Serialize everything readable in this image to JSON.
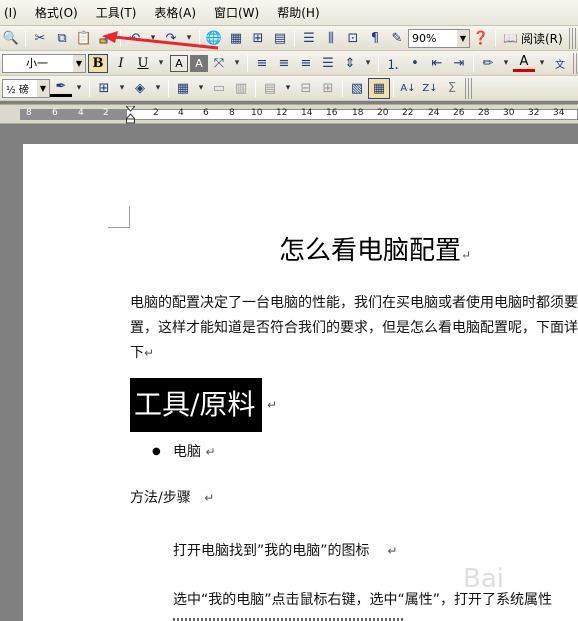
{
  "menu": {
    "items": [
      "(I)",
      "格式(O)",
      "工具(T)",
      "表格(A)",
      "窗口(W)",
      "帮助(H)"
    ]
  },
  "toolbar1": {
    "zoom_value": "90%",
    "read_label": "阅读(R)",
    "icons": [
      "print-preview-icon",
      "cut-icon",
      "copy-icon",
      "paste-icon",
      "format-painter-icon",
      "undo-icon",
      "redo-icon",
      "hyperlink-icon",
      "tables-borders-icon",
      "insert-table-icon",
      "insert-excel-icon",
      "columns-icon",
      "drawing-icon",
      "document-map-icon",
      "show-hide-icon",
      "help-icon"
    ]
  },
  "toolbar2": {
    "font_size": "小一",
    "bold": "B",
    "italic": "I",
    "underline": "U"
  },
  "toolbar3": {
    "line_weight": "½ 磅"
  },
  "ruler": {
    "left_numbers": [
      "8",
      "6",
      "4",
      "2"
    ],
    "right_numbers": [
      "2",
      "4",
      "6",
      "8",
      "10",
      "12",
      "14",
      "16",
      "18",
      "20",
      "22",
      "24",
      "26",
      "28",
      "30",
      "32",
      "34"
    ]
  },
  "document": {
    "title": "怎么看电脑配置",
    "intro_line1": "电脑的配置决定了一台电脑的性能，我们在买电脑或者使用电脑时都须要了",
    "intro_line2": "置，这样才能知道是否符合我们的要求，但是怎么看电脑配置呢，下面详细",
    "intro_line3": "下",
    "heading": "工具/原料",
    "bullet_item": "电脑",
    "method_heading": "方法/步骤",
    "step1": "打开电脑找到”我的电脑”的图标",
    "step2": "选中“我的电脑”点击鼠标右键，选中“属性”，打开了系统属性",
    "paragraph_mark": "↵",
    "watermark": "Bai"
  },
  "colors": {
    "annotation_arrow": "#e8262b",
    "toolbar_bg": "#ece9d8",
    "page_bg": "#ffffff"
  }
}
